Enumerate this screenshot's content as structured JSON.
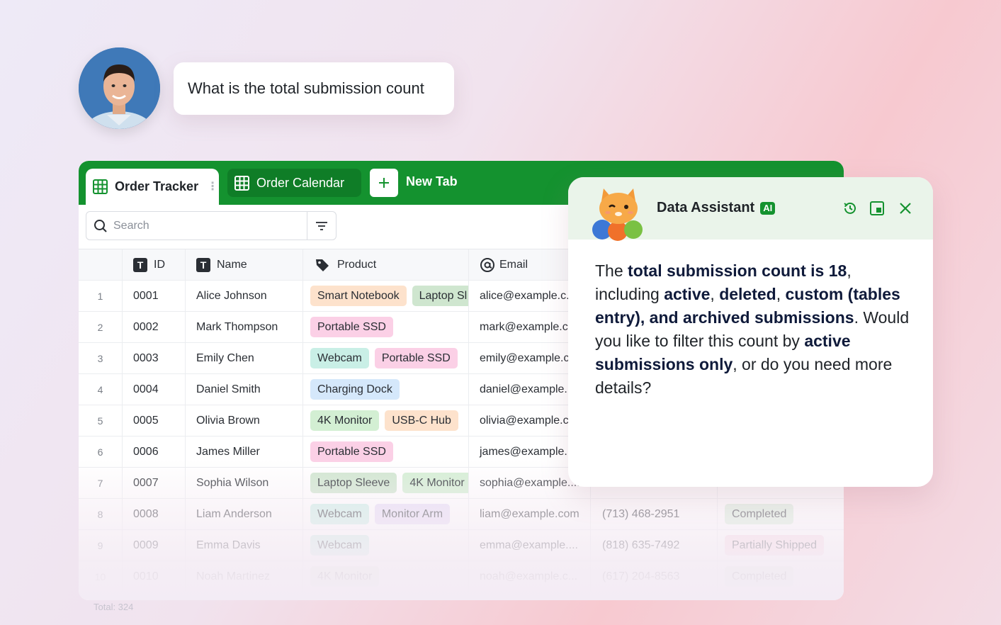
{
  "user_message": "What is the total submission count",
  "tabs": [
    {
      "label": "Order Tracker",
      "active": true
    },
    {
      "label": "Order Calendar",
      "active": false
    }
  ],
  "new_tab_label": "New Tab",
  "search": {
    "placeholder": "Search"
  },
  "columns": [
    "ID",
    "Name",
    "Product",
    "Email"
  ],
  "rows": [
    {
      "num": "1",
      "id": "0001",
      "name": "Alice Johnson",
      "products": [
        "Smart Notebook",
        "Laptop Sl"
      ],
      "email": "alice@example.c...",
      "phone": "",
      "status": ""
    },
    {
      "num": "2",
      "id": "0002",
      "name": "Mark Thompson",
      "products": [
        "Portable SSD"
      ],
      "email": "mark@example.c...",
      "phone": "",
      "status": ""
    },
    {
      "num": "3",
      "id": "0003",
      "name": "Emily Chen",
      "products": [
        "Webcam",
        "Portable SSD"
      ],
      "email": "emily@example.c...",
      "phone": "",
      "status": ""
    },
    {
      "num": "4",
      "id": "0004",
      "name": "Daniel Smith",
      "products": [
        "Charging Dock"
      ],
      "email": "daniel@example....",
      "phone": "",
      "status": ""
    },
    {
      "num": "5",
      "id": "0005",
      "name": "Olivia Brown",
      "products": [
        "4K Monitor",
        "USB-C Hub"
      ],
      "email": "olivia@example.c...",
      "phone": "",
      "status": ""
    },
    {
      "num": "6",
      "id": "0006",
      "name": "James Miller",
      "products": [
        "Portable SSD"
      ],
      "email": "james@example....",
      "phone": "",
      "status": ""
    },
    {
      "num": "7",
      "id": "0007",
      "name": "Sophia Wilson",
      "products": [
        "Laptop Sleeve",
        "4K Monitor"
      ],
      "email": "sophia@example....",
      "phone": "",
      "status": ""
    },
    {
      "num": "8",
      "id": "0008",
      "name": "Liam Anderson",
      "products": [
        "Webcam",
        "Monitor Arm"
      ],
      "email": "liam@example.com",
      "phone": "(713) 468-2951",
      "status": "Completed"
    },
    {
      "num": "9",
      "id": "0009",
      "name": "Emma Davis",
      "products": [
        "Webcam"
      ],
      "email": "emma@example....",
      "phone": "(818) 635-7492",
      "status": "Partially Shipped"
    },
    {
      "num": "10",
      "id": "0010",
      "name": "Noah Martinez",
      "products": [
        "4K Monitor"
      ],
      "email": "noah@example.c...",
      "phone": "(617) 204-8563",
      "status": "Completed"
    }
  ],
  "product_colors": {
    "Smart Notebook": "#fde2cc",
    "Laptop Sl": "#cfe6cf",
    "Laptop Sleeve": "#cfe6cf",
    "Portable SSD": "#fbd0e6",
    "Webcam": "#c9efe6",
    "Charging Dock": "#d5e8fb",
    "4K Monitor": "#d3efd3",
    "USB-C Hub": "#fde2cc",
    "Monitor Arm": "#e6dcf7"
  },
  "status_colors": {
    "Completed": "#d9f0dc",
    "Partially Shipped": "#fbd9e4"
  },
  "footer_total": "Total: 324",
  "assistant": {
    "title": "Data Assistant",
    "badge": "AI",
    "icons": [
      "history-icon",
      "picture-in-picture-icon",
      "close-icon"
    ],
    "message": [
      {
        "t": "The ",
        "b": false
      },
      {
        "t": "total submission count is 18",
        "b": true
      },
      {
        "t": ", including ",
        "b": false
      },
      {
        "t": "active",
        "b": true
      },
      {
        "t": ", ",
        "b": false
      },
      {
        "t": "deleted",
        "b": true
      },
      {
        "t": ", ",
        "b": false
      },
      {
        "t": "custom (tables entry), and archived submissions",
        "b": true
      },
      {
        "t": ". Would you like to filter this count by ",
        "b": false
      },
      {
        "t": "active submissions only",
        "b": true
      },
      {
        "t": ", or do you need more details?",
        "b": false
      }
    ]
  },
  "accent_color": "#14922f"
}
